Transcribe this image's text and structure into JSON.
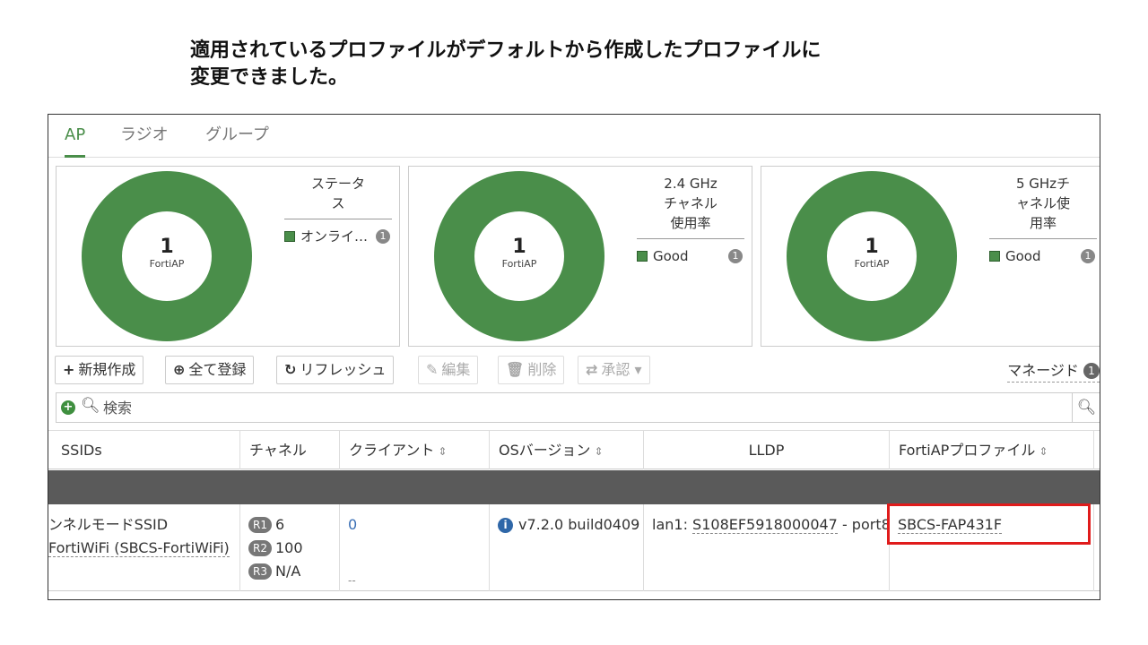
{
  "caption": {
    "line1": "適用されているプロファイルがデフォルトから作成したプロファイルに",
    "line2": "変更できました。"
  },
  "tabs": [
    {
      "label": "AP",
      "active": true
    },
    {
      "label": "ラジオ",
      "active": false
    },
    {
      "label": "グループ",
      "active": false
    }
  ],
  "cards": [
    {
      "count": "1",
      "count_label": "FortiAP",
      "title": "ステータス",
      "legend_label": "オンライ…",
      "legend_count": "1"
    },
    {
      "count": "1",
      "count_label": "FortiAP",
      "title": "2.4 GHz チャネル使用率",
      "legend_label": "Good",
      "legend_count": "1"
    },
    {
      "count": "1",
      "count_label": "FortiAP",
      "title": "5 GHzチャネル使用率",
      "legend_label": "Good",
      "legend_count": "1"
    }
  ],
  "toolbar": {
    "create_new": "新規作成",
    "register_all": "全て登録",
    "refresh": "リフレッシュ",
    "edit": "編集",
    "delete": "削除",
    "authorize": "承認",
    "managed_label": "マネージド",
    "managed_count": "1"
  },
  "search": {
    "placeholder": "検索"
  },
  "table": {
    "headers": [
      "SSIDs",
      "チャネル",
      "クライアント",
      "OSバージョン",
      "LLDP",
      "FortiAPプロファイル"
    ],
    "row": {
      "ssid_line1": "ンネルモードSSID",
      "ssid_line2": "FortiWiFi (SBCS-FortiWiFi)",
      "channels": [
        {
          "radio": "R1",
          "value": "6"
        },
        {
          "radio": "R2",
          "value": "100"
        },
        {
          "radio": "R3",
          "value": "N/A"
        }
      ],
      "clients": "0",
      "clients_sub": "--",
      "os_version": "v7.2.0 build0409",
      "lldp_prefix": "lan1: ",
      "lldp_device": "S108EF5918000047",
      "lldp_suffix": " - port8",
      "profile": "SBCS-FAP431F"
    }
  },
  "colors": {
    "accent_green": "#4a8e4a",
    "highlight_red": "#e01b1b",
    "group_row": "#5a5a5a"
  }
}
